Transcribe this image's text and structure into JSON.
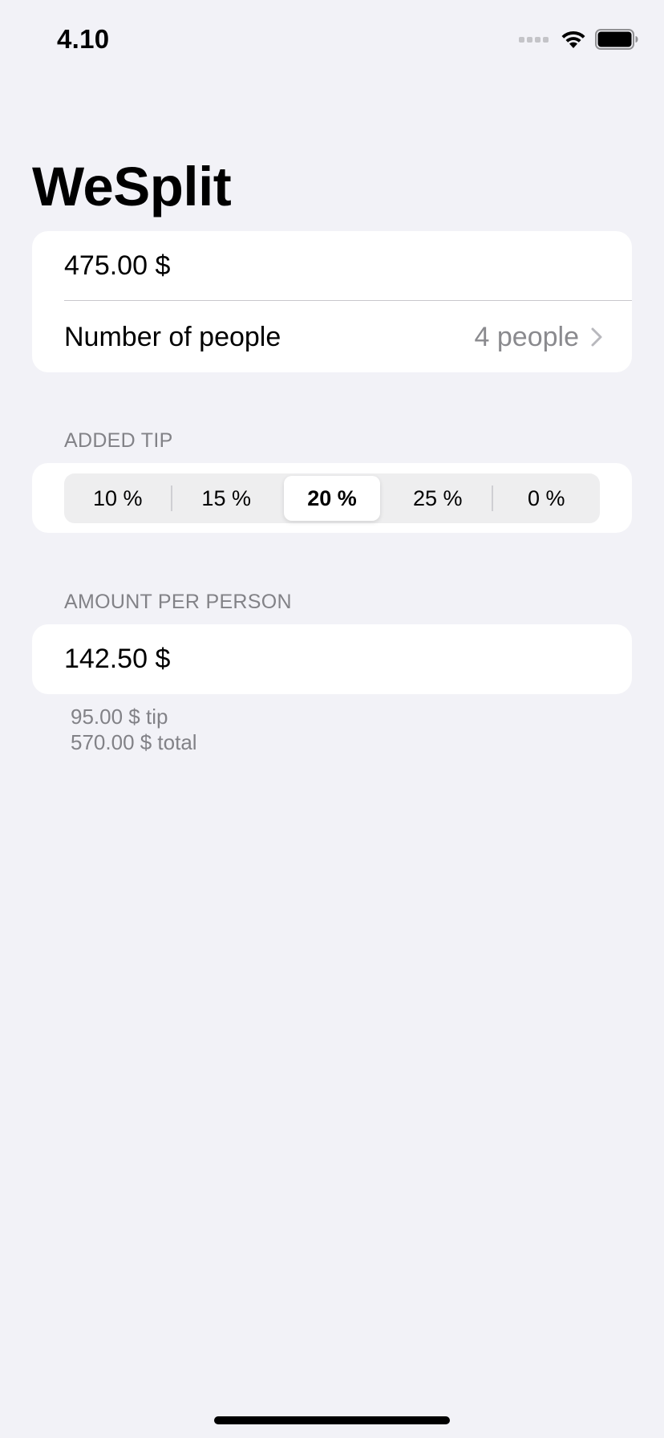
{
  "status_bar": {
    "time": "4.10",
    "icons": [
      "cellular-signal-icon",
      "wifi-icon",
      "battery-icon"
    ]
  },
  "title": "WeSplit",
  "check": {
    "amount": "475.00 $",
    "people_label": "Number of people",
    "people_value": "4 people"
  },
  "tip": {
    "header": "ADDED TIP",
    "options": [
      "10 %",
      "15 %",
      "20 %",
      "25 %",
      "0 %"
    ],
    "selected": "20 %"
  },
  "result": {
    "header": "AMOUNT PER PERSON",
    "per_person": "142.50 $",
    "tip_line": "95.00 $ tip",
    "total_line": "570.00 $ total"
  },
  "colors": {
    "background": "#F2F2F7",
    "card": "#FFFFFF",
    "secondary_text": "#828287"
  }
}
